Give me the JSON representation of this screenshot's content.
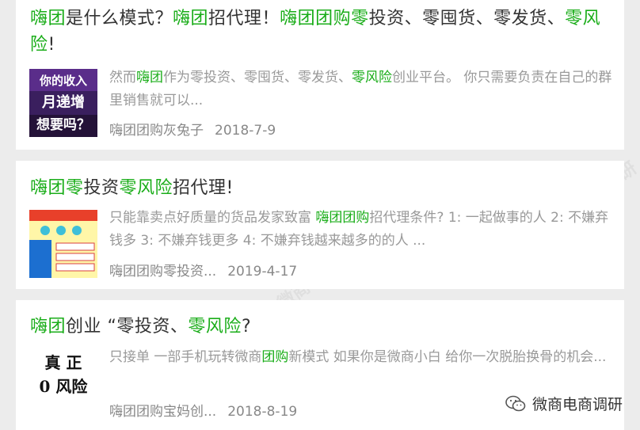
{
  "articles": [
    {
      "title_parts": [
        {
          "t": "嗨团",
          "hl": true
        },
        {
          "t": "是什么模式？",
          "hl": false
        },
        {
          "t": "嗨团",
          "hl": true
        },
        {
          "t": "招代理！",
          "hl": false
        },
        {
          "t": "嗨团团购零",
          "hl": true
        },
        {
          "t": "投资、零囤货、零发货、",
          "hl": false
        },
        {
          "t": "零风险",
          "hl": true
        },
        {
          "t": "!",
          "hl": false
        }
      ],
      "excerpt_parts": [
        {
          "t": "然而",
          "hl": false
        },
        {
          "t": "嗨团",
          "hl": true
        },
        {
          "t": "作为零投资、零囤货、零发货、",
          "hl": false
        },
        {
          "t": "零风险",
          "hl": true
        },
        {
          "t": "创业平台。 你只需要负责在自己的群里销售就可以...",
          "hl": false
        }
      ],
      "author": "嗨团团购灰兔子",
      "date": "2018-7-9"
    },
    {
      "title_parts": [
        {
          "t": "嗨团零",
          "hl": true
        },
        {
          "t": "投资",
          "hl": false
        },
        {
          "t": "零风险",
          "hl": true
        },
        {
          "t": "招代理!",
          "hl": false
        }
      ],
      "excerpt_parts": [
        {
          "t": "只能靠卖点好质量的货品发家致富 ",
          "hl": false
        },
        {
          "t": "嗨团团购",
          "hl": true
        },
        {
          "t": "招代理条件? 1: 一起做事的人 2: 不嫌弃钱多 3: 不嫌弃钱更多 4: 不嫌弃钱越来越多的的人 ...",
          "hl": false
        }
      ],
      "author": "嗨团团购零投资...",
      "date": "2019-4-17"
    },
    {
      "title_parts": [
        {
          "t": "嗨团",
          "hl": true
        },
        {
          "t": "创业 “零投资、",
          "hl": false
        },
        {
          "t": "零风险",
          "hl": true
        },
        {
          "t": "?",
          "hl": false
        }
      ],
      "excerpt_parts": [
        {
          "t": "只接单 一部手机玩转微商",
          "hl": false
        },
        {
          "t": "团购",
          "hl": true
        },
        {
          "t": "新模式 如果你是微商小白 给你一次脱胎换骨的机会...",
          "hl": false
        }
      ],
      "author": "嗨团团购宝妈创...",
      "date": "2018-8-19"
    }
  ],
  "thumbs": {
    "t1_lines": [
      "你的收入",
      "月递增",
      "想要吗？"
    ],
    "t3_lines": [
      "真 正",
      "0 风险"
    ]
  },
  "brand": {
    "name": "微商电商调研",
    "icon": "wechat-icon"
  },
  "watermark_text": "微商电商调研",
  "colors": {
    "highlight": "#1aad19",
    "text": "#333333",
    "muted": "#999999",
    "background": "#ececec"
  }
}
